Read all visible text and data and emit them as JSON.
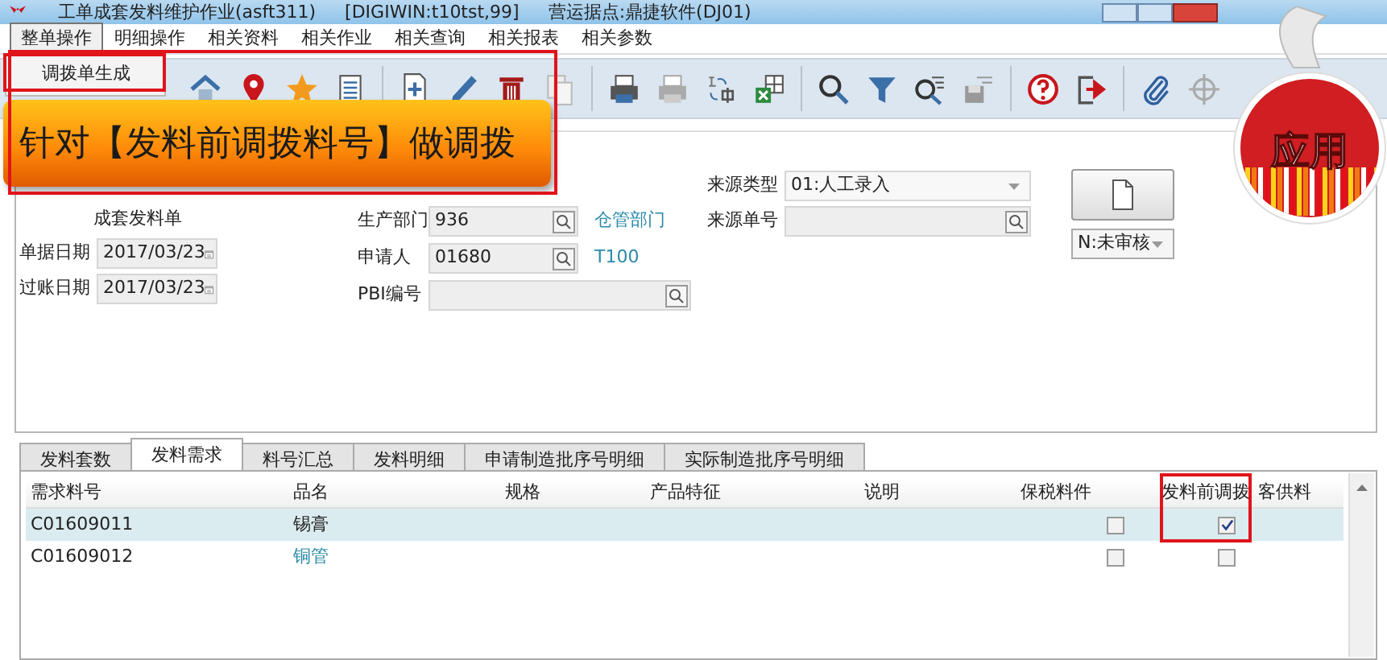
{
  "window": {
    "title_parts": [
      "工单成套发料维护作业(asft311)",
      "[DIGIWIN:t10tst,99]",
      "营运据点:鼎捷软件(DJ01)"
    ]
  },
  "menu": [
    {
      "label": "整单操作",
      "selected": true
    },
    {
      "label": "明细操作",
      "selected": false
    },
    {
      "label": "相关资料",
      "selected": false
    },
    {
      "label": "相关作业",
      "selected": false
    },
    {
      "label": "相关查询",
      "selected": false
    },
    {
      "label": "相关报表",
      "selected": false
    },
    {
      "label": "相关参数",
      "selected": false
    }
  ],
  "dropdown": {
    "items": [
      {
        "label": "调拨单生成"
      }
    ]
  },
  "callout": "针对【发料前调拨料号】做调拨",
  "badge": "应用",
  "form": {
    "left_note": "成套发料单",
    "left": [
      {
        "label": "单据日期",
        "value": "2017/03/23",
        "kind": "date"
      },
      {
        "label": "过账日期",
        "value": "2017/03/23",
        "kind": "date"
      }
    ],
    "middle": [
      {
        "label": "生产部门",
        "value": "936",
        "kind": "lookup",
        "link": "仓管部门"
      },
      {
        "label": "申请人",
        "value": "01680",
        "kind": "lookup",
        "link": "T100"
      },
      {
        "label": "PBI编号",
        "kind": "lookup-wide"
      }
    ],
    "right": [
      {
        "label": "来源类型",
        "value": "01:人工录入",
        "kind": "select"
      },
      {
        "label": "来源单号",
        "kind": "lookup"
      }
    ],
    "status": "N:未审核"
  },
  "tabs": [
    {
      "label": "发料套数",
      "selected": false
    },
    {
      "label": "发料需求",
      "selected": true
    },
    {
      "label": "料号汇总",
      "selected": false
    },
    {
      "label": "发料明细",
      "selected": false
    },
    {
      "label": "申请制造批序号明细",
      "selected": false
    },
    {
      "label": "实际制造批序号明细",
      "selected": false
    }
  ],
  "table": {
    "columns": [
      "需求料号",
      "品名",
      "规格",
      "产品特征",
      "说明",
      "保税料件",
      "发料前调拨",
      "客供料"
    ],
    "rows": [
      {
        "item_no": "C01609011",
        "name": "锡膏",
        "name_linked": false,
        "bonded": false,
        "pre_transfer": true,
        "selected": true
      },
      {
        "item_no": "C01609012",
        "name": "铜管",
        "name_linked": true,
        "bonded": false,
        "pre_transfer": false,
        "selected": false
      }
    ]
  }
}
